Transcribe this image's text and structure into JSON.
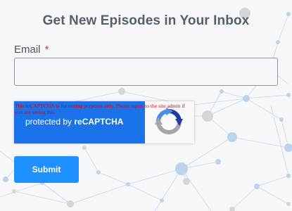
{
  "form": {
    "title": "Get New Episodes in Your Inbox",
    "email_label": "Email",
    "required_marker": "*",
    "email_value": "",
    "email_placeholder": "",
    "submit_label": "Submit"
  },
  "recaptcha": {
    "warning": "This reCAPTCHA is for testing purposes only. Please report to the site admin if you are seeing this.",
    "protected_prefix": "protected by",
    "brand": "reCAPTCHA",
    "icon": "recaptcha-logo"
  },
  "colors": {
    "title": "#56606b",
    "required": "#d63638",
    "recaptcha_panel": "#1a73e8",
    "warning_text": "#d0021b",
    "submit_button": "#1e90ff",
    "background": "#f6f7f9",
    "network": "#bcd3ea"
  },
  "background": {
    "decoration": "network-graph"
  }
}
